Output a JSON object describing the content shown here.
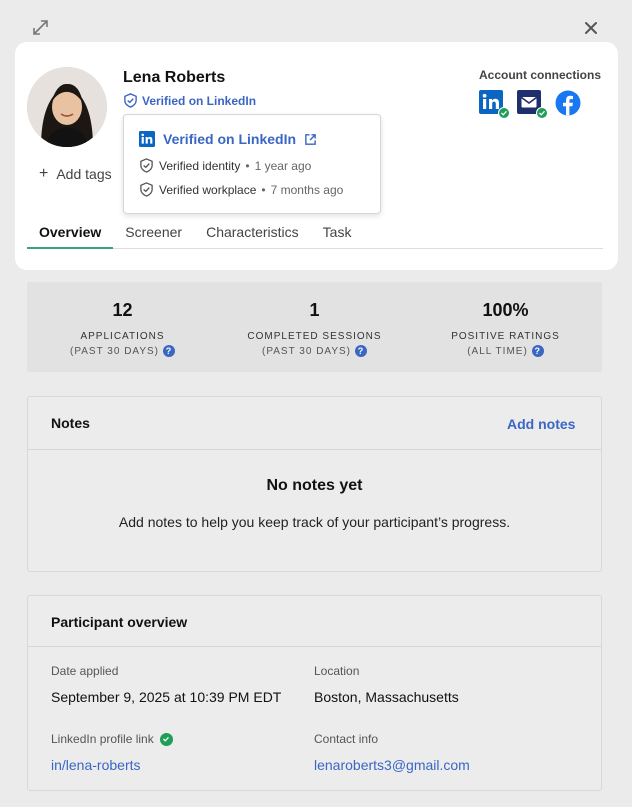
{
  "profile": {
    "name": "Lena Roberts",
    "verified_label": "Verified on LinkedIn",
    "add_tags_label": "Add tags"
  },
  "account_connections": {
    "title": "Account connections",
    "icons": [
      "linkedin-icon",
      "email-icon",
      "facebook-icon"
    ]
  },
  "popover": {
    "title": "Verified on LinkedIn",
    "identity_label": "Verified identity",
    "identity_time": "1 year ago",
    "workplace_label": "Verified workplace",
    "workplace_time": "7 months ago",
    "separator": "•"
  },
  "tabs": [
    "Overview",
    "Screener",
    "Characteristics",
    "Task"
  ],
  "stats": [
    {
      "value": "12",
      "caption": "APPLICATIONS",
      "sub": "(PAST 30 DAYS)"
    },
    {
      "value": "1",
      "caption": "COMPLETED SESSIONS",
      "sub": "(PAST 30 DAYS)"
    },
    {
      "value": "100%",
      "caption": "POSITIVE RATINGS",
      "sub": "(ALL TIME)"
    }
  ],
  "notes": {
    "title": "Notes",
    "add_label": "Add notes",
    "empty_title": "No notes yet",
    "empty_desc": "Add notes to help you keep track of your participant’s progress."
  },
  "overview": {
    "title": "Participant overview",
    "date_applied_label": "Date applied",
    "date_applied_value": "September 9, 2025 at 10:39 PM EDT",
    "location_label": "Location",
    "location_value": "Boston, Massachusetts",
    "linkedin_label": "LinkedIn profile link",
    "linkedin_value": "in/lena-roberts",
    "contact_label": "Contact info",
    "contact_value": "lenaroberts3@gmail.com"
  },
  "colors": {
    "accent_blue": "#3a66c4",
    "tab_underline": "#3aa37a",
    "verified_green": "#1e9e57",
    "linkedin_blue": "#0a66c2",
    "facebook_blue": "#1877f2",
    "email_navy": "#1f2f6e"
  }
}
